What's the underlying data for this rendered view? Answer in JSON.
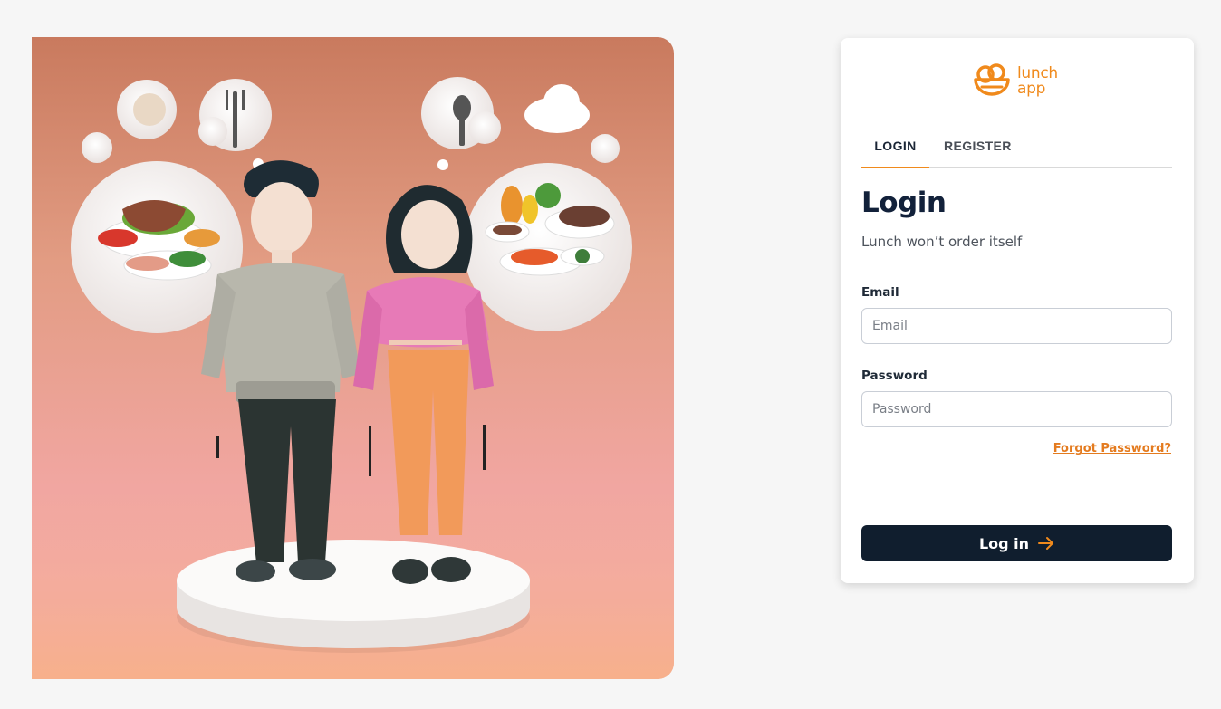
{
  "hero": {
    "image_name": "people-dreaming-of-lunch-illustration"
  },
  "brand": {
    "logo_line1": "lunch",
    "logo_line2": "app",
    "accent": "#f08a1c",
    "dark": "#101e2e"
  },
  "tabs": [
    {
      "label": "LOGIN",
      "active": true
    },
    {
      "label": "REGISTER",
      "active": false
    }
  ],
  "form": {
    "title": "Login",
    "subtitle": "Lunch won’t order itself",
    "email_label": "Email",
    "email_placeholder": "Email",
    "email_value": "",
    "password_label": "Password",
    "password_placeholder": "Password",
    "password_value": "",
    "forgot_label": "Forgot Password?",
    "submit_label": "Log in",
    "submit_icon": "arrow-right-icon"
  }
}
